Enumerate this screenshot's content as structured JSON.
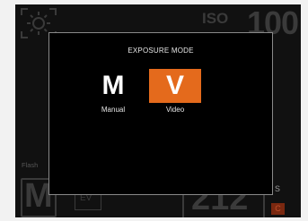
{
  "background": {
    "sun_icon": "sun-icon",
    "iso_label": "ISO",
    "iso_value": "100",
    "flash_label": "Flash",
    "mode_letter": "M",
    "ev_label": "EV",
    "shutter_value": "212",
    "shutter_unit": "s",
    "c_badge": "C"
  },
  "dialog": {
    "title": "EXPOSURE MODE",
    "options": [
      {
        "letter": "M",
        "label": "Manual",
        "selected": false
      },
      {
        "letter": "V",
        "label": "Video",
        "selected": true
      }
    ]
  },
  "colors": {
    "accent": "#e46a1c",
    "dialog_border": "#8a8a8a",
    "page_bg": "#f2f2f2",
    "screen_bg": "#111111"
  }
}
